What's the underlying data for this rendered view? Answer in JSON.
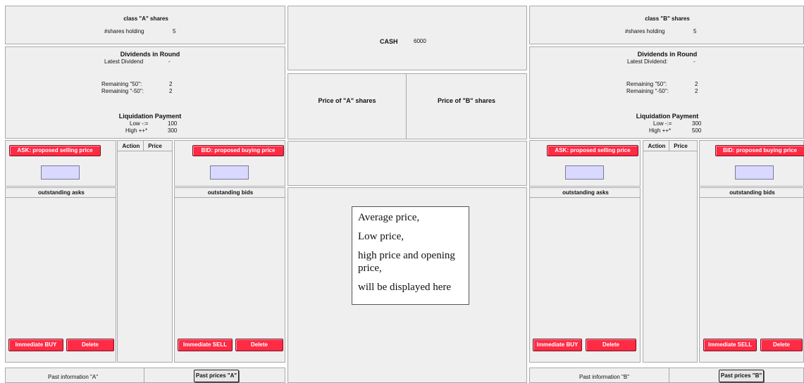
{
  "left": {
    "title": "class \"A\" shares",
    "holding_label": "#shares holding",
    "holding_value": "5",
    "dividends_title": "Dividends in Round",
    "latest_label": "Latest Dividend",
    "latest_value": "-",
    "rem50_label": "Remaining \"50\":",
    "rem50_value": "2",
    "remm50_label": "Remaining \"-50\":",
    "remm50_value": "2",
    "liq_title": "Liquidation Payment",
    "low_label": "Low -:=",
    "low_value": "100",
    "high_label": "High ++*",
    "high_value": "300",
    "ask_button": "ASK: proposed selling price",
    "bid_button": "BID: proposed buying price",
    "col_action": "Action",
    "col_price": "Price",
    "outstanding_asks": "outstanding asks",
    "outstanding_bids": "outstanding bids",
    "buy_button": "Immediate BUY",
    "delete_button_1": "Delete",
    "sell_button": "Immediate SELL",
    "delete_button_2": "Delete",
    "past_info": "Past information \"A\"",
    "past_prices_button": "Past prices \"A\""
  },
  "right": {
    "title": "class \"B\" shares",
    "holding_label": "#shares holding",
    "holding_value": "5",
    "dividends_title": "Dividends in Round",
    "latest_label": "Latest Dividend:",
    "latest_value": "-",
    "rem50_label": "Remaining \"50\":",
    "rem50_value": "2",
    "remm50_label": "Remaining \"-50\":",
    "remm50_value": "2",
    "liq_title": "Liquidation Payment",
    "low_label": "Low -:=",
    "low_value": "300",
    "high_label": "High ++*",
    "high_value": "500",
    "ask_button": "ASK: proposed selling price",
    "bid_button": "BID: proposed buying price",
    "col_action": "Action",
    "col_price": "Price",
    "outstanding_asks": "outstanding asks",
    "outstanding_bids": "outstanding bids",
    "buy_button": "Immediate BUY",
    "delete_button_1": "Delete",
    "sell_button": "Immediate SELL",
    "delete_button_2": "Delete",
    "past_info": "Past information \"B\"",
    "past_prices_button": "Past prices \"B\""
  },
  "center": {
    "cash_label": "CASH",
    "cash_value": "6000",
    "price_a_label": "Price of \"A\" shares",
    "price_b_label": "Price of \"B\" shares",
    "info_lines": [
      "Average price,",
      "Low price,",
      "high price and opening price,",
      "will be displayed here"
    ]
  },
  "colors": {
    "panel_bg": "#efefef",
    "border": "#a9a9a9",
    "button_red": "#ff2a44",
    "input_lavender": "#d9d9ff"
  }
}
